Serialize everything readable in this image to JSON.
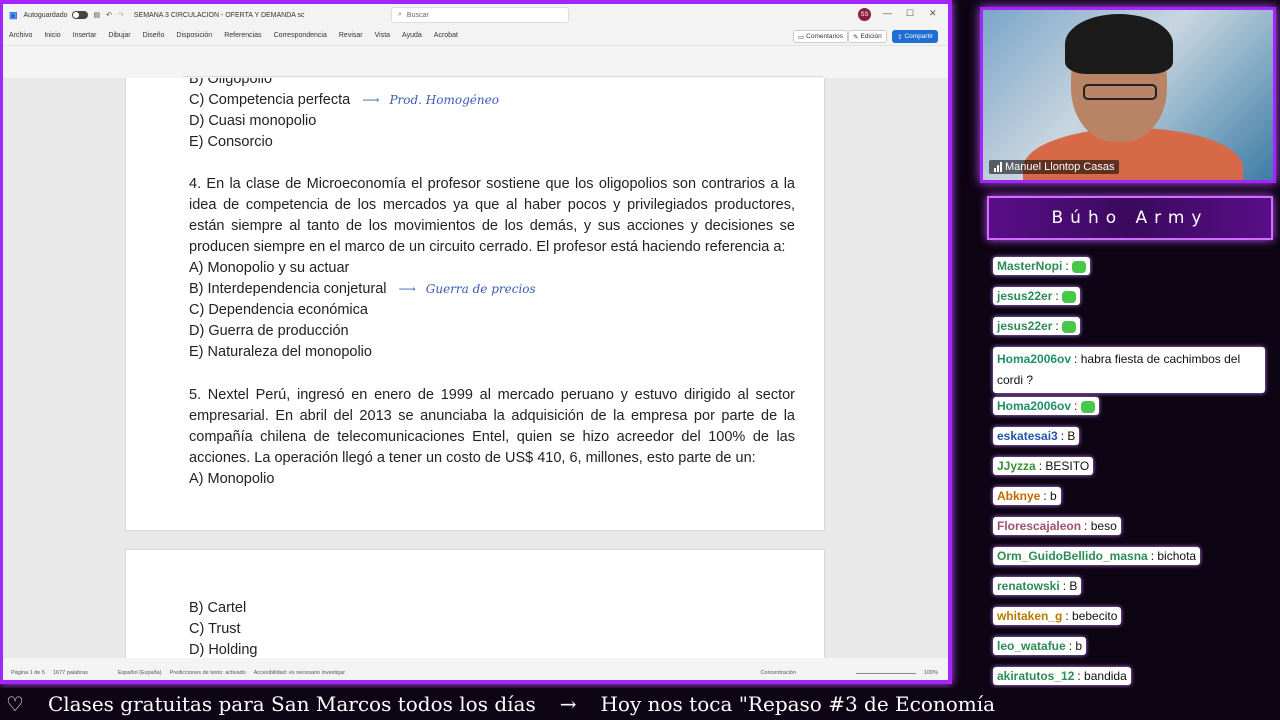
{
  "word": {
    "autosave_label": "Autoguardado",
    "doc_title": "SEMANA 3 CIRCULACION - OFERTA Y DEMANDA sc",
    "search_placeholder": "Buscar",
    "avatar_initials": "SS",
    "ribbon_tabs": [
      "Archivo",
      "Inicio",
      "Insertar",
      "Dibujar",
      "Diseño",
      "Disposición",
      "Referencias",
      "Correspondencia",
      "Revisar",
      "Vista",
      "Ayuda",
      "Acrobat"
    ],
    "comments_btn": "Comentarios",
    "editing_btn": "Edición",
    "share_btn": "Compartir",
    "page1": {
      "q3_opts": [
        "B) Oligopolio",
        "C) Competencia perfecta",
        "D) Cuasi monopolio",
        "E) Consorcio"
      ],
      "q3_note": "Prod. Homogéneo",
      "q4_text": "4. En la clase de Microeconomía el profesor sostiene que los oligopolios son contrarios a la idea de competencia de los mercados ya que al haber pocos y privilegiados productores, están siempre al tanto de los movimientos de los demás, y sus acciones y decisiones se producen siempre en el marco de un circuito cerrado. El profesor está haciendo referencia a:",
      "q4_opts": [
        "A) Monopolio y su actuar",
        "B) Interdependencia conjetural",
        "C) Dependencia económica",
        "D) Guerra de producción",
        "E) Naturaleza del monopolio"
      ],
      "q4_note": "Guerra de precios",
      "q5_text": "5. Nextel Perú, ingresó en enero de 1999 al mercado peruano y estuvo dirigido al sector empresarial. En abril del 2013 se anunciaba la adquisición de la empresa por parte de la compañía chilena de telecomunicaciones Entel, quien se hizo acreedor del 100% de las acciones. La operación llegó a tener un costo de US$ 410, 6, millones, esto parte de un:",
      "q5_opt_a": "A) Monopolio"
    },
    "page2": {
      "q5_opts": [
        "B) Cartel",
        "C) Trust",
        "D) Holding"
      ]
    },
    "status": {
      "page": "Página 1 de 5",
      "words": "1677 palabras",
      "lang": "Español (España)",
      "predictions": "Predicciones de texto: activado",
      "access": "Accesibilidad: es necesario investigar",
      "focus": "Concentración",
      "zoom": "100%"
    }
  },
  "cam": {
    "name": "Manuel Llontop Casas"
  },
  "chat": {
    "title": "Búho Army",
    "messages": [
      {
        "user": "MasterNopi",
        "text": "",
        "emote": true,
        "color": "#2e8b57"
      },
      {
        "user": "jesus22er",
        "text": "",
        "emote": true,
        "color": "#2e8b57"
      },
      {
        "user": "jesus22er",
        "text": "",
        "emote": true,
        "color": "#2e8b57"
      },
      {
        "user": "Homa2006ov",
        "text": "habra fiesta de cachimbos del cordi ?",
        "emote": false,
        "color": "#1f8f6a"
      },
      {
        "user": "Homa2006ov",
        "text": "",
        "emote": true,
        "color": "#1f8f6a"
      },
      {
        "user": "eskatesai3",
        "text": "B",
        "emote": false,
        "color": "#2255aa"
      },
      {
        "user": "JJyzza",
        "text": "BESITO",
        "emote": false,
        "color": "#3a8f3a"
      },
      {
        "user": "Abknye",
        "text": "b",
        "emote": false,
        "color": "#c46a00"
      },
      {
        "user": "Florescajaleon",
        "text": "beso",
        "emote": false,
        "color": "#a05070"
      },
      {
        "user": "Orm_GuidoBellido_masna",
        "text": "bichota",
        "emote": false,
        "color": "#2e8b57"
      },
      {
        "user": "renatowski",
        "text": "B",
        "emote": false,
        "color": "#2e8b57"
      },
      {
        "user": "whitaken_g",
        "text": "bebecito",
        "emote": false,
        "color": "#b87a00"
      },
      {
        "user": "leo_watafue",
        "text": "b",
        "emote": false,
        "color": "#2e8b57"
      },
      {
        "user": "akiratutos_12",
        "text": "bandida",
        "emote": false,
        "color": "#2e8b57"
      }
    ]
  },
  "ticker": {
    "heart": "♡",
    "text1": "Clases gratuitas para San Marcos todos los días",
    "arrow": "→",
    "text2": "Hoy nos toca \"Repaso #3 de Economía"
  }
}
